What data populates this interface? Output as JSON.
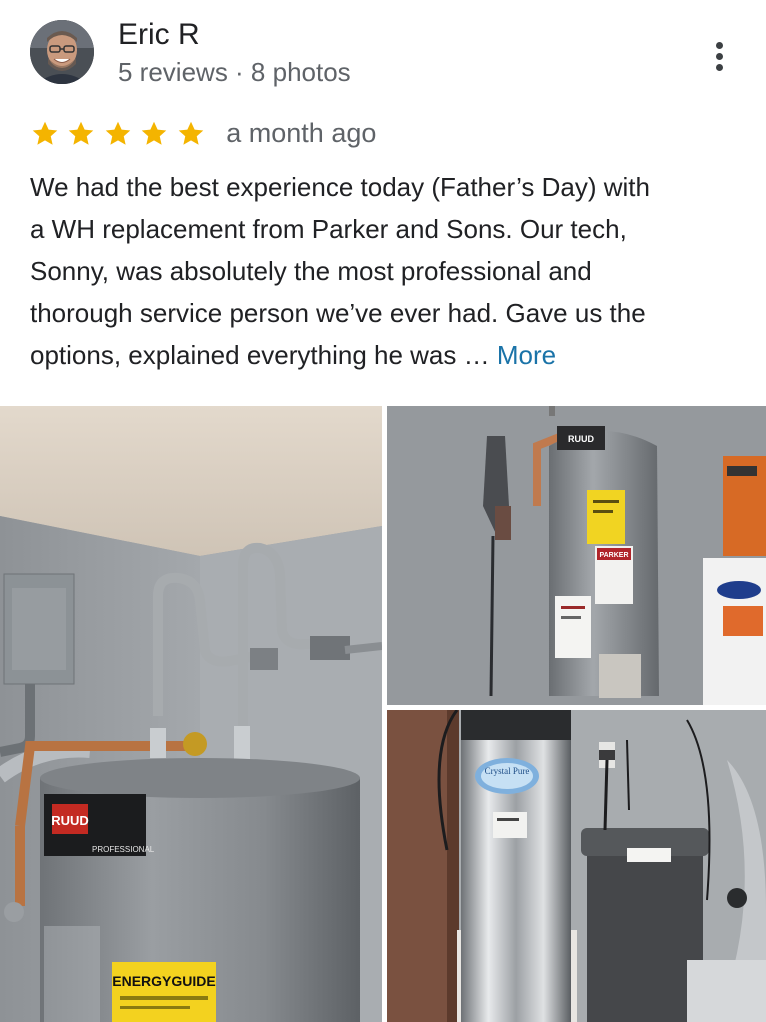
{
  "reviewer": {
    "name": "Eric R",
    "meta": "5 reviews · 8 photos"
  },
  "rating": {
    "stars": 5,
    "max": 5,
    "star_color": "#F4B400",
    "date": "a month ago"
  },
  "review": {
    "lines": [
      "We had the best experience today (Father’s Day) with",
      "a WH replacement from Parker and Sons.  Our tech,",
      "Sonny, was absolutely the most professional and",
      "thorough service person we’ve ever had.  Gave us the",
      "options, explained everything he was … "
    ],
    "more_label": "More",
    "link_color": "#1a73a8"
  },
  "photos": {
    "photo_1": {
      "brand": "RUUD",
      "series": "PROFESSIONAL",
      "label": "ENERGYGUIDE"
    },
    "photo_2": {
      "brand": "RUUD",
      "sticker": "PARKER"
    },
    "photo_3": {
      "brand": "Crystal Pure"
    }
  },
  "icons": {
    "menu": "more-vert-icon",
    "star": "star-icon"
  }
}
